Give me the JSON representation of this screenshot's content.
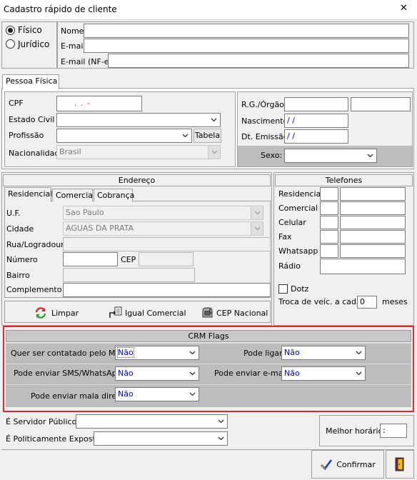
{
  "window": {
    "title": "Cadastro rápido de cliente",
    "close_glyph": "✕"
  },
  "tipo": {
    "fisico_label": "Físico",
    "juridico_label": "Jurídico",
    "selected": "Físico"
  },
  "header_fields": {
    "nome_label": "Nome",
    "nome_value": "",
    "email_label": "E-mail",
    "email_value": "",
    "email_nfe_label": "E-mail (NF-e)",
    "email_nfe_value": ""
  },
  "pessoa_tab": "Pessoa Física",
  "pessoa": {
    "cpf_label": "CPF",
    "cpf_mask": ".     .     -",
    "estado_civil_label": "Estado Civil",
    "estado_civil_value": "",
    "profissao_label": "Profissão",
    "profissao_value": "",
    "tabela_button": "Tabela",
    "nacionalidade_label": "Nacionalidade",
    "nacionalidade_value": "Brasil",
    "rg_label": "R.G./Órgão",
    "rg_value": "",
    "orgao_value": "",
    "nascimento_label": "Nascimento",
    "nascimento_value": " / /",
    "dt_emissao_label": "Dt. Emissão",
    "dt_emissao_value": " / /",
    "sexo_label": "Sexo:",
    "sexo_value": ""
  },
  "endereco": {
    "title": "Endereço",
    "tabs": [
      "Residencial",
      "Comercial",
      "Cobrança"
    ],
    "uf_label": "U.F.",
    "uf_value": "Sao Paulo",
    "cidade_label": "Cidade",
    "cidade_value": "AGUAS DA PRATA",
    "rua_label": "Rua/Logradouro",
    "rua_value": "",
    "numero_label": "Número",
    "numero_value": "",
    "cep_label": "CEP",
    "cep_value": "",
    "bairro_label": "Bairro",
    "bairro_value": "",
    "complemento_label": "Complemento",
    "complemento_value": "",
    "limpar_button": "Limpar",
    "igual_comercial_button": "Igual Comercial",
    "cep_nacional_button": "CEP Nacional"
  },
  "telefones": {
    "title": "Telefones",
    "rows": [
      "Residencial",
      "Comercial",
      "Celular",
      "Fax",
      "Whatsapp"
    ],
    "radio_label": "Rádio",
    "dotz_label": "Dotz",
    "troca_label": "Troca de veíc. a cada",
    "troca_value": "0",
    "meses_label": "meses"
  },
  "crm": {
    "title": "CRM Flags",
    "contato_mkt_label": "Quer ser contatado pelo MKT",
    "contato_mkt_value": "Não",
    "pode_ligar_label": "Pode ligar",
    "pode_ligar_value": "Não",
    "sms_label": "Pode enviar SMS/WhatsApp",
    "sms_value": "Não",
    "email_label": "Pode enviar e-mail",
    "email_value": "Não",
    "mala_label": "Pode enviar mala direta",
    "mala_value": "Não",
    "highlight_color": "#e0282e"
  },
  "footer": {
    "servidor_label": "É Servidor Público",
    "servidor_value": "",
    "politico_label": "É Politicamente Exposto",
    "politico_value": "",
    "melhor_horario_label": "Melhor horário",
    "melhor_horario_value": ":",
    "confirmar_button": "Confirmar"
  }
}
